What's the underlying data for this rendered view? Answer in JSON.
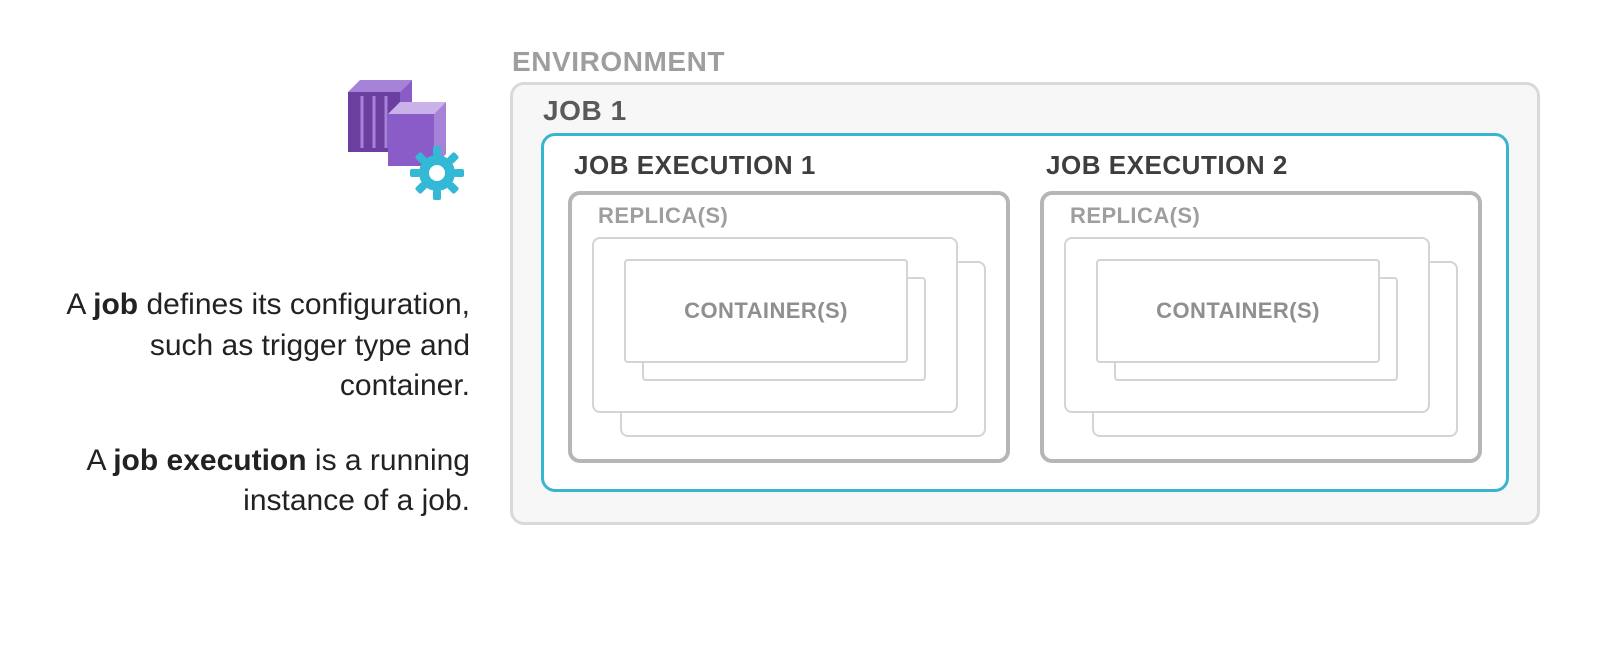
{
  "description": {
    "p1_pre": "A ",
    "p1_bold": "job",
    "p1_post": " defines its configuration, such as trigger type and container.",
    "p2_pre": "A ",
    "p2_bold": "job execution",
    "p2_post": " is a running instance of a job."
  },
  "diagram": {
    "environment_label": "ENVIRONMENT",
    "job_label": "JOB 1",
    "executions": [
      {
        "label": "JOB EXECUTION 1",
        "replica_label": "REPLICA(S)",
        "container_label": "CONTAINER(S)"
      },
      {
        "label": "JOB EXECUTION 2",
        "replica_label": "REPLICA(S)",
        "container_label": "CONTAINER(S)"
      }
    ]
  },
  "colors": {
    "job_border": "#39b5d2",
    "box_border": "#d9d9d9",
    "exec_border": "#b6b6b6",
    "muted_text": "#9e9e9e",
    "icon_purple_dark": "#6b3fa0",
    "icon_purple_light": "#a782d9",
    "icon_gear": "#33b8d6"
  }
}
